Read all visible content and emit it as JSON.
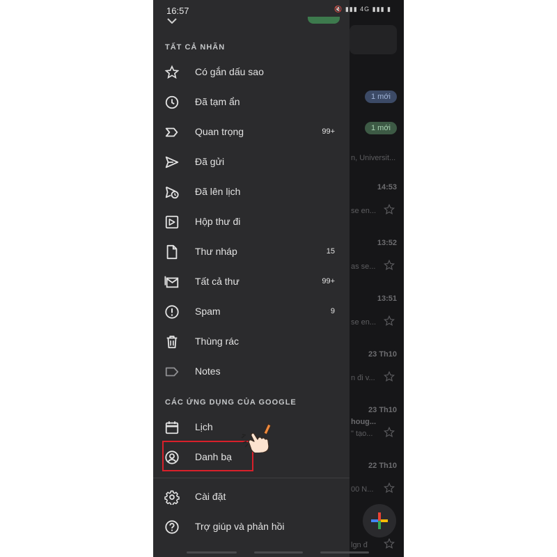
{
  "status_bar": {
    "time": "16:57",
    "icons": "🔇 ▮▮▮ 4G ▮▮▮ ▮"
  },
  "drawer": {
    "labels_header": "TẤT CẢ NHÃN",
    "labels": [
      {
        "label": "Có gắn dấu sao",
        "icon": "star-icon",
        "count": ""
      },
      {
        "label": "Đã tạm ẩn",
        "icon": "clock-icon",
        "count": ""
      },
      {
        "label": "Quan trọng",
        "icon": "important-icon",
        "count": "99+"
      },
      {
        "label": "Đã gửi",
        "icon": "send-icon",
        "count": ""
      },
      {
        "label": "Đã lên lịch",
        "icon": "scheduled-icon",
        "count": ""
      },
      {
        "label": "Hộp thư đi",
        "icon": "outbox-icon",
        "count": ""
      },
      {
        "label": "Thư nháp",
        "icon": "draft-icon",
        "count": "15"
      },
      {
        "label": "Tất cả thư",
        "icon": "all-mail-icon",
        "count": "99+"
      },
      {
        "label": "Spam",
        "icon": "spam-icon",
        "count": "9"
      },
      {
        "label": "Thùng rác",
        "icon": "trash-icon",
        "count": ""
      },
      {
        "label": "Notes",
        "icon": "label-icon",
        "count": ""
      }
    ],
    "apps_header": "CÁC ỨNG DỤNG CỦA GOOGLE",
    "apps": [
      {
        "label": "Lịch",
        "icon": "calendar-icon"
      },
      {
        "label": "Danh bạ",
        "icon": "contacts-icon"
      }
    ],
    "footer": [
      {
        "label": "Cài đặt",
        "icon": "gear-icon"
      },
      {
        "label": "Trợ giúp và phản hồi",
        "icon": "help-icon"
      }
    ]
  },
  "inbox_background": {
    "badges": [
      "1 mới",
      "1 mới"
    ],
    "snippets": [
      "n, Universit...",
      "se en...",
      "as se...",
      "se en...",
      "n đi v...",
      "houg...",
      "\" tạo...",
      "00 N...",
      "lgn đ"
    ],
    "times": [
      "14:53",
      "13:52",
      "13:51",
      "23 Th10",
      "23 Th10",
      "22 Th10"
    ]
  },
  "colors": {
    "drawer_bg": "#2b2b2d",
    "highlight": "#d8202a",
    "text": "#e3e3e3"
  }
}
